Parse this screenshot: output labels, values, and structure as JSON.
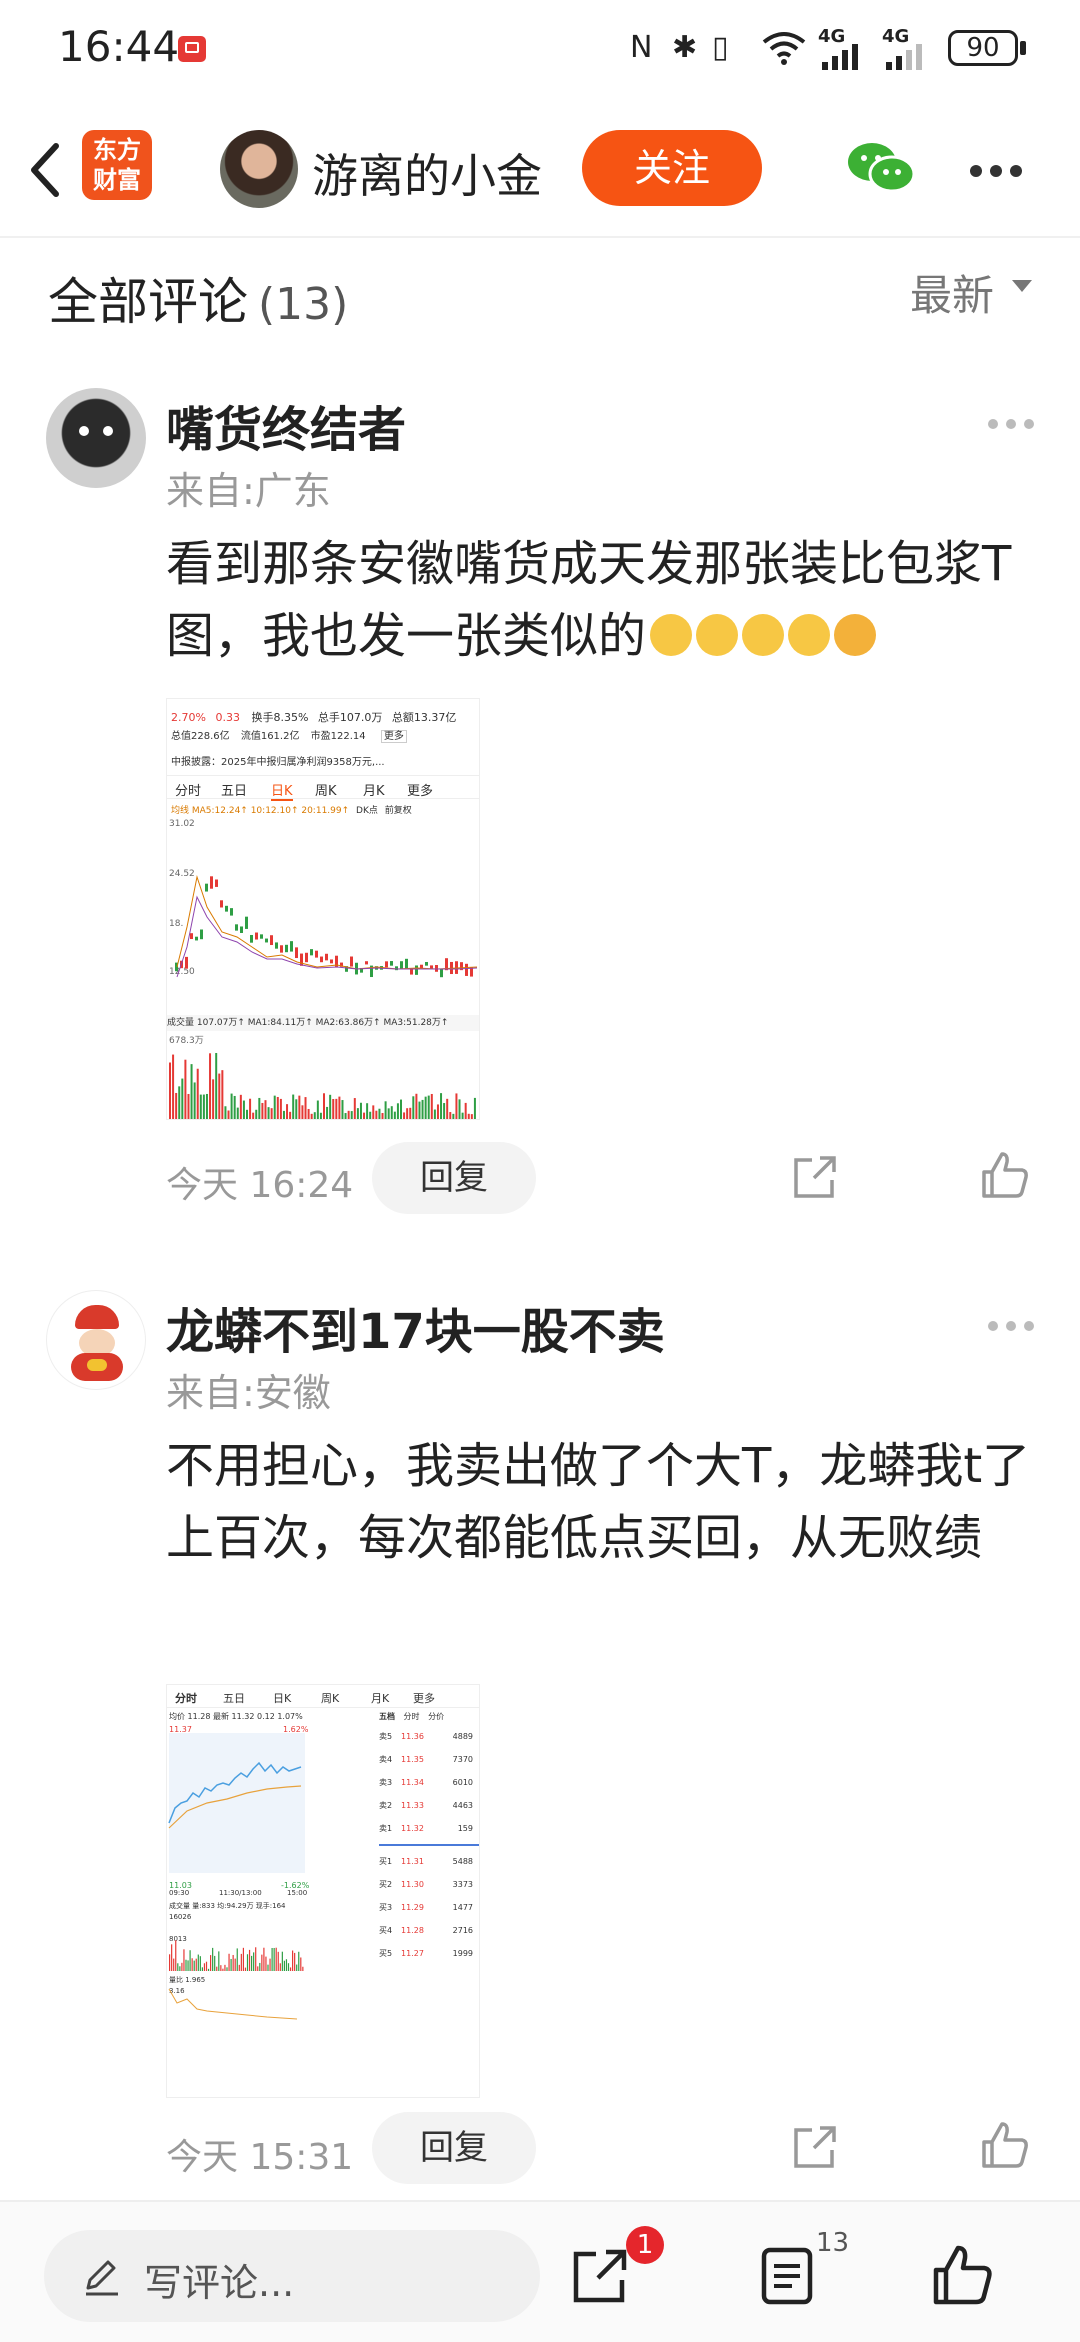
{
  "status_bar": {
    "time": "16:44",
    "network_a": "4G",
    "network_b": "4G",
    "battery": "90"
  },
  "header": {
    "logo_line1": "东方",
    "logo_line2": "财富",
    "author_name": "游离的小金",
    "follow_label": "关注"
  },
  "comments_section": {
    "title": "全部评论",
    "count": "(13)",
    "sort_label": "最新"
  },
  "comments": [
    {
      "user": "嘴货终结者",
      "location": "来自:广东",
      "text": "看到那条安徽嘴货成天发那张装比包浆T图，我也发一张类似的",
      "time": "今天 16:24",
      "reply_label": "回复",
      "chart_header": {
        "change_pct": "2.70%",
        "change": "0.33",
        "turnover_label": "换手",
        "turnover": "8.35%",
        "total_hands_label": "总手",
        "total_hands": "107.0万",
        "amount_label": "总额",
        "amount": "13.37亿",
        "mcap_label": "总值",
        "mcap": "228.6亿",
        "float_label": "流值",
        "float_cap": "161.2亿",
        "pe_label": "市盈",
        "pe": "122.14",
        "more": "更多",
        "news": "中报披露：2025年中报归属净利润9358万元,...",
        "tabs": [
          "分时",
          "五日",
          "日K",
          "周K",
          "月K",
          "更多"
        ],
        "ma_line": "均线 MA5:12.24↑ 10:12.10↑ 20:11.99↑",
        "dk": "DK点",
        "fq": "前复权",
        "y1": "31.02",
        "y2": "24.52",
        "y3": "18.",
        "y4": "12.50",
        "vol_line": "成交量 107.07万↑ MA1:84.11万↑ MA2:63.86万↑ MA3:51.28万↑",
        "vol_max": "678.3万"
      }
    },
    {
      "user": "龙蟒不到17块一股不卖",
      "location": "来自:安徽",
      "text": "不用担心，我卖出做了个大T，龙蟒我t了上百次，每次都能低点买回，从无败绩",
      "time": "今天 15:31",
      "reply_label": "回复",
      "chart_header": {
        "tabs": [
          "分时",
          "五日",
          "日K",
          "周K",
          "月K",
          "更多"
        ],
        "info": "均价 11.28 最新 11.32 0.12 1.07%",
        "top_price": "11.37",
        "top_pct": "1.62%",
        "low_price": "11.03",
        "low_pct": "-1.62%",
        "t1": "09:30",
        "t2": "11:30/13:00",
        "t3": "15:00",
        "vol_info": "成交量 量:833 均:94.29万 现手:164",
        "vol_max": "16026",
        "vol_mid": "8013",
        "ratio_label": "量比 1.965",
        "ratio_val": "3.16",
        "book_tabs": [
          "五档",
          "分时",
          "分价"
        ],
        "asks": [
          {
            "label": "卖5",
            "price": "11.36",
            "vol": "4889"
          },
          {
            "label": "卖4",
            "price": "11.35",
            "vol": "7370"
          },
          {
            "label": "卖3",
            "price": "11.34",
            "vol": "6010"
          },
          {
            "label": "卖2",
            "price": "11.33",
            "vol": "4463"
          },
          {
            "label": "卖1",
            "price": "11.32",
            "vol": "159"
          }
        ],
        "bids": [
          {
            "label": "买1",
            "price": "11.31",
            "vol": "5488"
          },
          {
            "label": "买2",
            "price": "11.30",
            "vol": "3373"
          },
          {
            "label": "买3",
            "price": "11.29",
            "vol": "1477"
          },
          {
            "label": "买4",
            "price": "11.28",
            "vol": "2716"
          },
          {
            "label": "买5",
            "price": "11.27",
            "vol": "1999"
          }
        ]
      }
    }
  ],
  "bottom_bar": {
    "placeholder": "写评论...",
    "share_badge": "1",
    "comment_count": "13"
  },
  "colors": {
    "accent": "#f65413",
    "up": "#e53935",
    "down": "#2e9e44"
  }
}
